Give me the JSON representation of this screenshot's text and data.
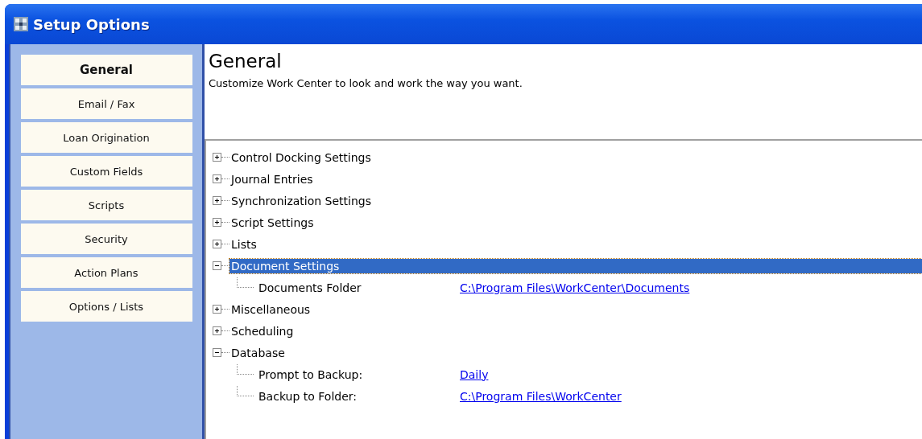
{
  "window": {
    "title": "Setup Options"
  },
  "sidebar": {
    "items": [
      {
        "label": "General",
        "selected": true
      },
      {
        "label": "Email / Fax",
        "selected": false
      },
      {
        "label": "Loan Origination",
        "selected": false
      },
      {
        "label": "Custom Fields",
        "selected": false
      },
      {
        "label": "Scripts",
        "selected": false
      },
      {
        "label": "Security",
        "selected": false
      },
      {
        "label": "Action Plans",
        "selected": false
      },
      {
        "label": "Options / Lists",
        "selected": false
      }
    ]
  },
  "header": {
    "title": "General",
    "description": "Customize Work Center to look and work the way you want."
  },
  "tree": {
    "items": [
      {
        "label": "Control Docking Settings",
        "expanded": false,
        "selected": false
      },
      {
        "label": "Journal Entries",
        "expanded": false,
        "selected": false
      },
      {
        "label": "Synchronization Settings",
        "expanded": false,
        "selected": false
      },
      {
        "label": "Script Settings",
        "expanded": false,
        "selected": false
      },
      {
        "label": "Lists",
        "expanded": false,
        "selected": false
      },
      {
        "label": "Document Settings",
        "expanded": true,
        "selected": true,
        "children": [
          {
            "label": "Documents Folder",
            "value": "C:\\Program Files\\WorkCenter\\Documents"
          }
        ]
      },
      {
        "label": "Miscellaneous",
        "expanded": false,
        "selected": false
      },
      {
        "label": "Scheduling",
        "expanded": false,
        "selected": false
      },
      {
        "label": "Database",
        "expanded": true,
        "selected": false,
        "children": [
          {
            "label": "Prompt to Backup:",
            "value": "Daily"
          },
          {
            "label": "Backup to Folder:",
            "value": "C:\\Program Files\\WorkCenter"
          }
        ]
      }
    ]
  }
}
